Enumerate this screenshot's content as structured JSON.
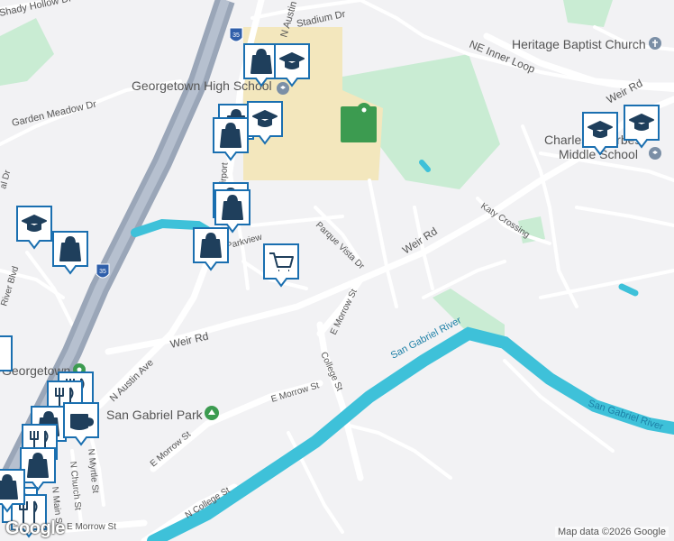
{
  "map": {
    "streets": {
      "shady_hollow": "Shady Hollow Dr",
      "austin_n_top": "N Austin",
      "stadium": "Stadium Dr",
      "garden_meadow": "Garden Meadow Dr",
      "ne_inner_loop": "NE Inner Loop",
      "weir_rd_ne": "Weir Rd",
      "weir_rd_mid": "Weir Rd",
      "weir_rd_w": "Weir Rd",
      "katy_crossing": "Katy Crossing",
      "parque_vista": "Parque Vista Dr",
      "parkview": "Parkview",
      "airport": "Airport",
      "e_morrow_upper": "E Morrow St",
      "college_st": "College St",
      "e_morrow_mid": "E Morrow St",
      "e_morrow_lower": "E Morrow St",
      "n_austin_ave": "N Austin Ave",
      "river_blvd": "River Blvd",
      "left_edge_dr": "al Dr",
      "n_college_st": "N College St",
      "n_church_st": "N Church St",
      "n_myrtle_st": "N Myrtle St",
      "n_main_st": "N Main St",
      "e_morrow_bottom": "E Morrow St",
      "san_gabriel_river_1": "San Gabriel River",
      "san_gabriel_river_2": "San Gabriel River",
      "interstate_shield_1": "35",
      "interstate_shield_2": "35"
    },
    "places": {
      "high_school": "Georgetown High School",
      "church": "Heritage Baptist Church",
      "middle_school_line1": "Charles A Forbes",
      "middle_school_line2": "Middle School",
      "park": "San Gabriel Park",
      "town": "Georgetown"
    },
    "attribution": "Map data ©2026 Google",
    "logo": "Google"
  },
  "colors": {
    "land": "#f2f2f4",
    "road": "#ffffff",
    "highway": "#9aa6b8",
    "water": "#3ec1d9",
    "park": "#c9ecd3",
    "school": "#f3e7bd",
    "pin": "#1a6fb0"
  }
}
